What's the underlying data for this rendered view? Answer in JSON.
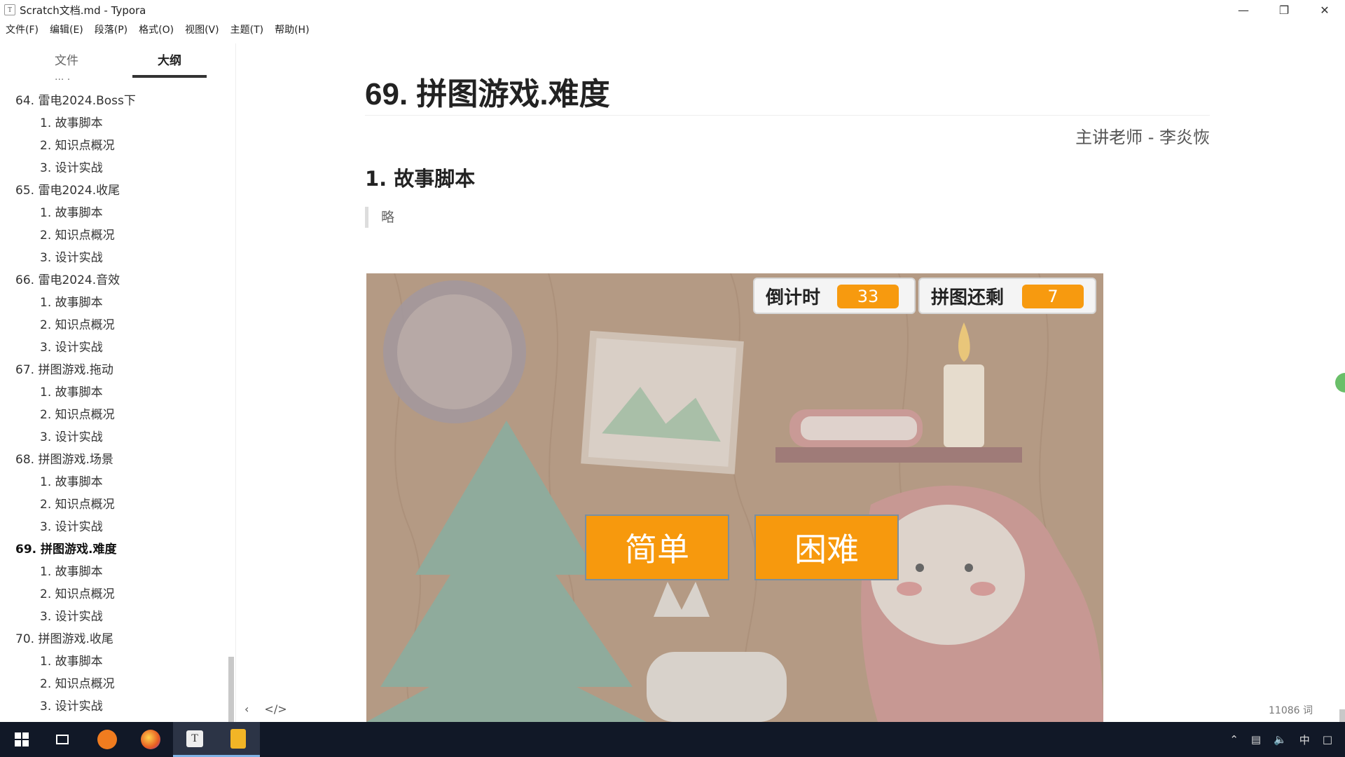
{
  "window": {
    "title": "Scratch文档.md - Typora",
    "app_icon_letter": "T"
  },
  "menu": [
    "文件(F)",
    "编辑(E)",
    "段落(P)",
    "格式(O)",
    "视图(V)",
    "主题(T)",
    "帮助(H)"
  ],
  "sidebar": {
    "tabs": [
      "文件",
      "大纲"
    ],
    "active_tab": "大纲",
    "outline": [
      {
        "text": "64. 雷电2024.Boss下",
        "level": 1
      },
      {
        "text": "1. 故事脚本",
        "level": 2
      },
      {
        "text": "2. 知识点概况",
        "level": 2
      },
      {
        "text": "3. 设计实战",
        "level": 2
      },
      {
        "text": "65. 雷电2024.收尾",
        "level": 1
      },
      {
        "text": "1. 故事脚本",
        "level": 2
      },
      {
        "text": "2. 知识点概况",
        "level": 2
      },
      {
        "text": "3. 设计实战",
        "level": 2
      },
      {
        "text": "66. 雷电2024.音效",
        "level": 1
      },
      {
        "text": "1. 故事脚本",
        "level": 2
      },
      {
        "text": "2. 知识点概况",
        "level": 2
      },
      {
        "text": "3. 设计实战",
        "level": 2
      },
      {
        "text": "67. 拼图游戏.拖动",
        "level": 1
      },
      {
        "text": "1. 故事脚本",
        "level": 2
      },
      {
        "text": "2. 知识点概况",
        "level": 2
      },
      {
        "text": "3. 设计实战",
        "level": 2
      },
      {
        "text": "68. 拼图游戏.场景",
        "level": 1
      },
      {
        "text": "1. 故事脚本",
        "level": 2
      },
      {
        "text": "2. 知识点概况",
        "level": 2
      },
      {
        "text": "3. 设计实战",
        "level": 2
      },
      {
        "text": "69. 拼图游戏.难度",
        "level": 1,
        "current": true
      },
      {
        "text": "1. 故事脚本",
        "level": 2
      },
      {
        "text": "2. 知识点概况",
        "level": 2
      },
      {
        "text": "3. 设计实战",
        "level": 2
      },
      {
        "text": "70. 拼图游戏.收尾",
        "level": 1
      },
      {
        "text": "1. 故事脚本",
        "level": 2
      },
      {
        "text": "2. 知识点概况",
        "level": 2
      },
      {
        "text": "3. 设计实战",
        "level": 2
      }
    ]
  },
  "document": {
    "h1": "69. 拼图游戏.难度",
    "teacher": "主讲老师 - 李炎恢",
    "h2": "1. 故事脚本",
    "quote": "略"
  },
  "game": {
    "monitors": [
      {
        "label": "倒计时",
        "value": "33"
      },
      {
        "label": "拼图还剩",
        "value": "7"
      }
    ],
    "buttons": [
      "简单",
      "困难"
    ],
    "colors": {
      "background": "#b49a84",
      "accent": "#f7990d"
    }
  },
  "footer": {
    "word_count": "11086 词"
  },
  "taskbar": {
    "tray": {
      "ime": "中"
    }
  }
}
